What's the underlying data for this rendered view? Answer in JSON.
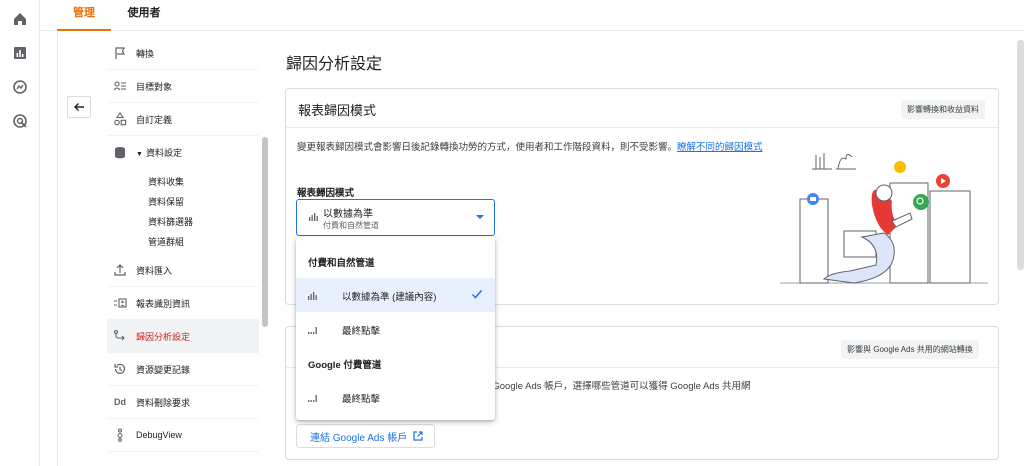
{
  "tabs": {
    "admin": "管理",
    "user": "使用者"
  },
  "nav": {
    "items": [
      {
        "label": "轉換",
        "icon": "flag-icon"
      },
      {
        "label": "目標對象",
        "icon": "audience-icon"
      },
      {
        "label": "自訂定義",
        "icon": "shapes-icon"
      },
      {
        "label": "資料設定",
        "icon": "database-icon"
      },
      {
        "label": "資料匯入",
        "icon": "upload-icon"
      },
      {
        "label": "報表識別資訊",
        "icon": "identity-icon"
      },
      {
        "label": "歸因分析設定",
        "icon": "attribution-icon"
      },
      {
        "label": "資源變更記錄",
        "icon": "history-icon"
      },
      {
        "label": "資料刪除要求",
        "icon": "dd-icon"
      },
      {
        "label": "DebugView",
        "icon": "debug-icon"
      }
    ],
    "dd_glyph": "Dd",
    "sub_items": [
      "資料收集",
      "資料保留",
      "資料篩選器",
      "管道群組"
    ]
  },
  "page": {
    "title": "歸因分析設定"
  },
  "card1": {
    "title": "報表歸因模式",
    "chip": "影響轉換和收益資料",
    "desc_text": "變更報表歸因模式會影響日後記錄轉換功勞的方式，使用者和工作階段資料，則不受影響。",
    "desc_link": "瞭解不同的歸因模式",
    "field_label": "報表歸因模式",
    "select": {
      "value": "以數據為準",
      "sub": "付費和自然管道"
    }
  },
  "dropdown": {
    "group1": "付費和自然管道",
    "opt1": "以數據為準 (建議內容)",
    "opt2": "最終點擊",
    "group2": "Google 付費管道",
    "opt3": "最終點擊"
  },
  "card2": {
    "chip": "影響與 Google Ads 共用的網站轉換",
    "desc_visible": "帳戶，選擇哪些管道可以獲得 Google Ads 共用網",
    "desc_prefix": "s Google Ads",
    "link_button": "連結 Google Ads 帳戶"
  },
  "colors": {
    "accent": "#e8710a",
    "link": "#1a73e8",
    "active_nav": "#c5221f"
  }
}
